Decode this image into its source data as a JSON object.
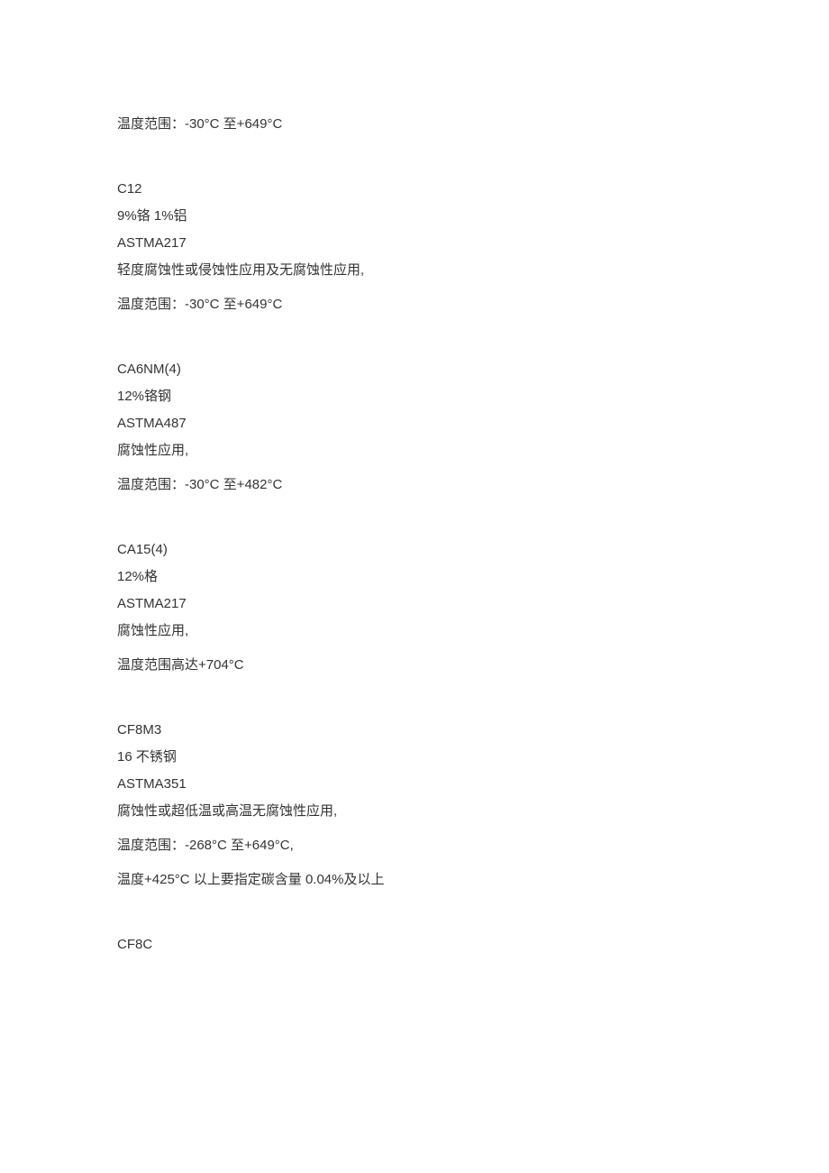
{
  "entries": [
    {
      "lines": [
        "温度范围：-30°C 至+649°C"
      ]
    },
    {
      "lines": [
        "C12",
        "9%铬 1%铝",
        "ASTMA217",
        "轻度腐蚀性或侵蚀性应用及无腐蚀性应用,",
        "温度范围：-30°C 至+649°C"
      ]
    },
    {
      "lines": [
        "CA6NM(4)",
        "12%铬钢",
        "ASTMA487",
        "腐蚀性应用,",
        "温度范围：-30°C 至+482°C"
      ]
    },
    {
      "lines": [
        "CA15(4)",
        "12%格",
        "ASTMA217",
        "腐蚀性应用,",
        "温度范围高达+704°C"
      ]
    },
    {
      "lines": [
        "CF8M3",
        "16 不锈钢",
        "ASTMA351",
        "腐蚀性或超低温或高温无腐蚀性应用,",
        "温度范围：-268°C 至+649°C,",
        "温度+425°C 以上要指定碳含量 0.04%及以上"
      ]
    },
    {
      "lines": [
        "CF8C"
      ]
    }
  ]
}
